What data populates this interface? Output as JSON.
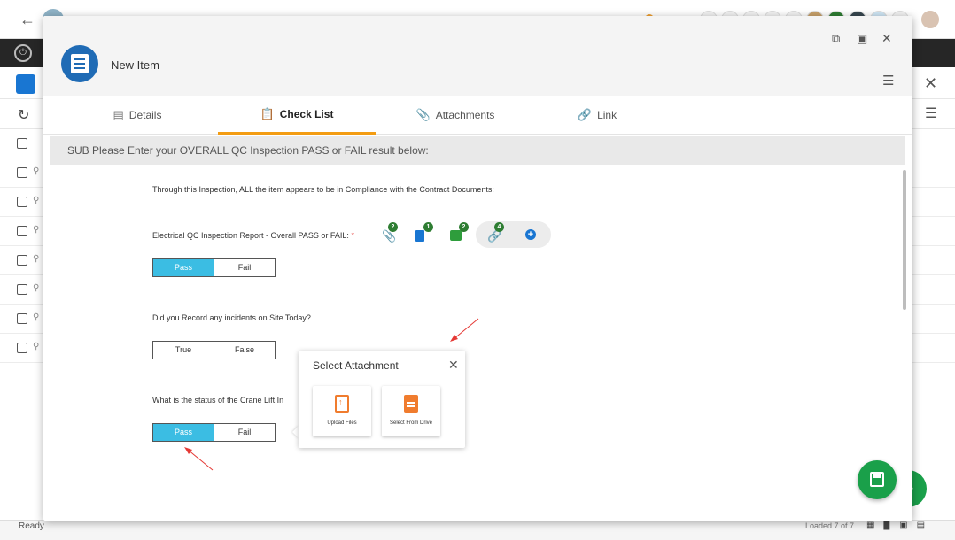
{
  "modal": {
    "title": "New Item"
  },
  "tabs": [
    {
      "label": "Details",
      "icon": "details-icon"
    },
    {
      "label": "Check List",
      "icon": "checklist-icon"
    },
    {
      "label": "Attachments",
      "icon": "paperclip-icon"
    },
    {
      "label": "Link",
      "icon": "link-icon"
    }
  ],
  "section": {
    "title": "SUB Please Enter your OVERALL QC Inspection PASS or FAIL result below:"
  },
  "questions": [
    {
      "text": "Through this Inspection, ALL the item appears to be in Compliance with the Contract Documents:"
    },
    {
      "text": "Electrical QC Inspection Report - Overall PASS or FAIL:",
      "required_mark": "*",
      "options": [
        "Pass",
        "Fail"
      ],
      "selected": "Pass"
    },
    {
      "text": "Did you Record any incidents on Site Today?",
      "options": [
        "True",
        "False"
      ],
      "selected": ""
    },
    {
      "text": "What is the status of the Crane Lift In",
      "options": [
        "Pass",
        "Fail"
      ],
      "selected": "Pass"
    }
  ],
  "badges": {
    "attachments": "2",
    "documents": "1",
    "comments": "2",
    "links": "4"
  },
  "popup": {
    "title": "Select Attachment",
    "upload_label": "Upload Files",
    "drive_label": "Select From Drive"
  },
  "background": {
    "status": "Ready",
    "loaded": "Loaded 7 of 7"
  },
  "colors": {
    "accent_tab": "#f39c12",
    "segment_selected": "#3bbde3",
    "save_fab": "#1aa04a",
    "logo": "#1f6bb5"
  }
}
